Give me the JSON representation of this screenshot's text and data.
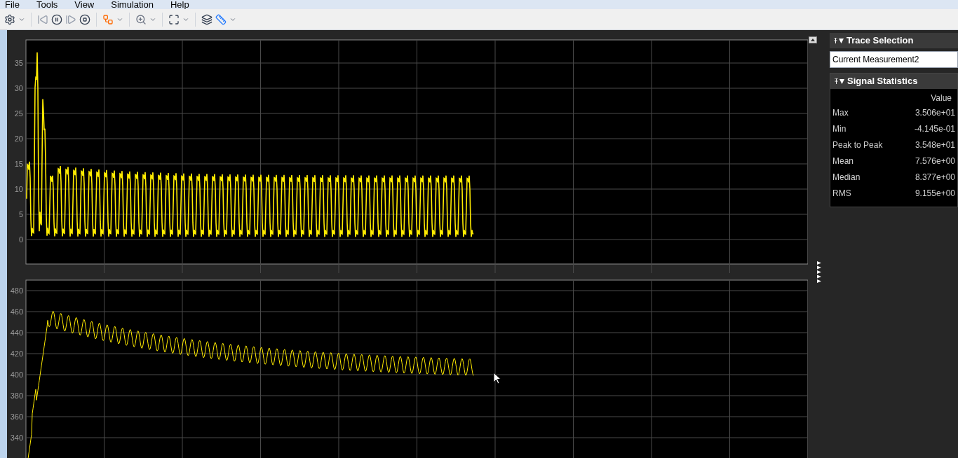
{
  "menu": [
    "File",
    "Tools",
    "View",
    "Simulation",
    "Help"
  ],
  "plots": [
    {
      "y_tick_labels": [
        "35",
        "30",
        "25",
        "20",
        "15",
        "10",
        "5",
        "0"
      ]
    },
    {
      "y_tick_labels": [
        "480",
        "460",
        "440",
        "420",
        "400",
        "380",
        "360",
        "340"
      ]
    }
  ],
  "trace_selection": {
    "title": "Trace Selection",
    "value": "Current Measurement2"
  },
  "signal_statistics": {
    "title": "Signal Statistics",
    "column": "Value",
    "rows": [
      {
        "label": "Max",
        "value": "3.506e+01"
      },
      {
        "label": "Min",
        "value": "-4.145e-01"
      },
      {
        "label": "Peak to Peak",
        "value": "3.548e+01"
      },
      {
        "label": "Mean",
        "value": "7.576e+00"
      },
      {
        "label": "Median",
        "value": "8.377e+00"
      },
      {
        "label": "RMS",
        "value": "9.155e+00"
      }
    ]
  }
}
